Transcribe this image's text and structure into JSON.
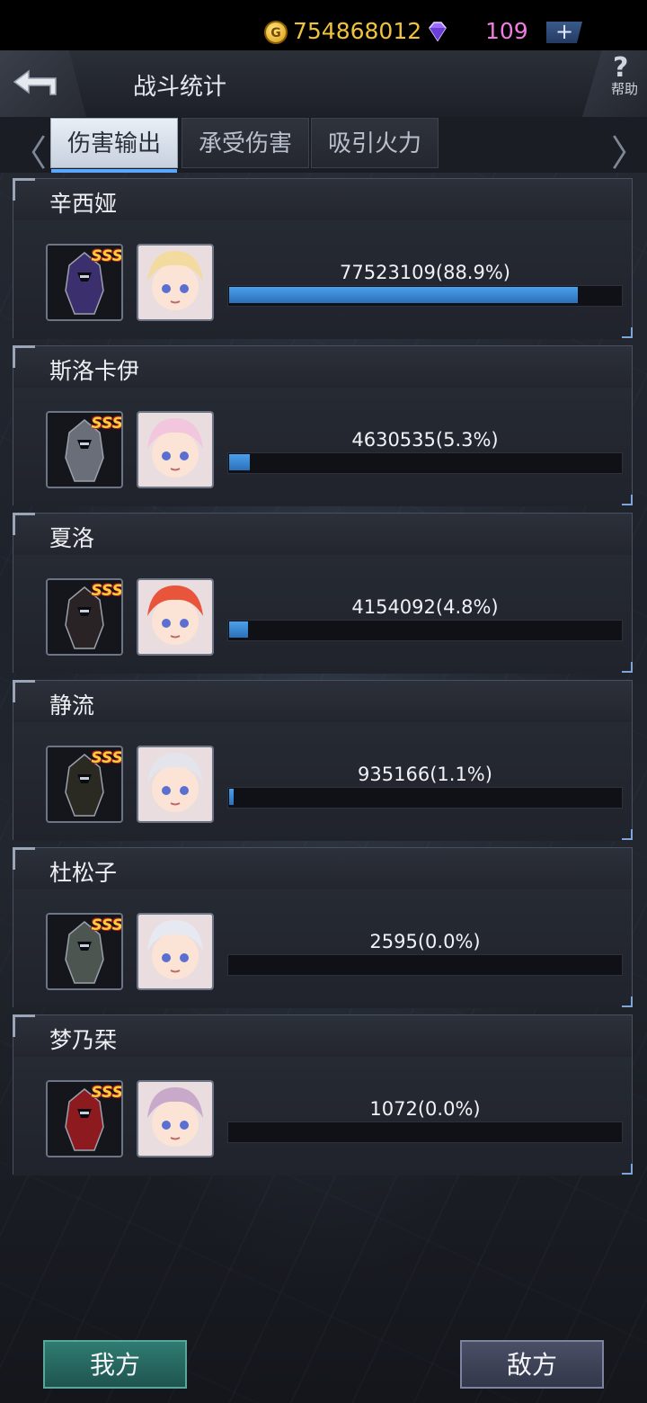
{
  "header": {
    "title": "战斗统计",
    "gold": "754868012",
    "gems": "109",
    "help_label": "帮助",
    "help_symbol": "?",
    "plus_symbol": "+"
  },
  "tabs": [
    {
      "label": "伤害输出",
      "active": true
    },
    {
      "label": "承受伤害",
      "active": false
    },
    {
      "label": "吸引火力",
      "active": false
    }
  ],
  "nav": {
    "prev_symbol": "〈",
    "next_symbol": "〉"
  },
  "rank_badge": "SSS",
  "entries": [
    {
      "name": "辛西娅",
      "damage": "77523109(88.9%)",
      "share": 0.889,
      "mech_color": "#3b2f6e",
      "girl_color": "#f3dba0"
    },
    {
      "name": "斯洛卡伊",
      "damage": "4630535(5.3%)",
      "share": 0.053,
      "mech_color": "#6a6e78",
      "girl_color": "#f2c6dc"
    },
    {
      "name": "夏洛",
      "damage": "4154092(4.8%)",
      "share": 0.048,
      "mech_color": "#2a2326",
      "girl_color": "#e8553b"
    },
    {
      "name": "静流",
      "damage": "935166(1.1%)",
      "share": 0.011,
      "mech_color": "#2b2a22",
      "girl_color": "#e3e4ec"
    },
    {
      "name": "杜松子",
      "damage": "2595(0.0%)",
      "share": 0.0,
      "mech_color": "#4d5550",
      "girl_color": "#e7e9f2"
    },
    {
      "name": "梦乃栞",
      "damage": "1072(0.0%)",
      "share": 0.0,
      "mech_color": "#8c1a1f",
      "girl_color": "#c9a9c9"
    }
  ],
  "buttons": {
    "my_side": "我方",
    "enemy_side": "敌方"
  }
}
